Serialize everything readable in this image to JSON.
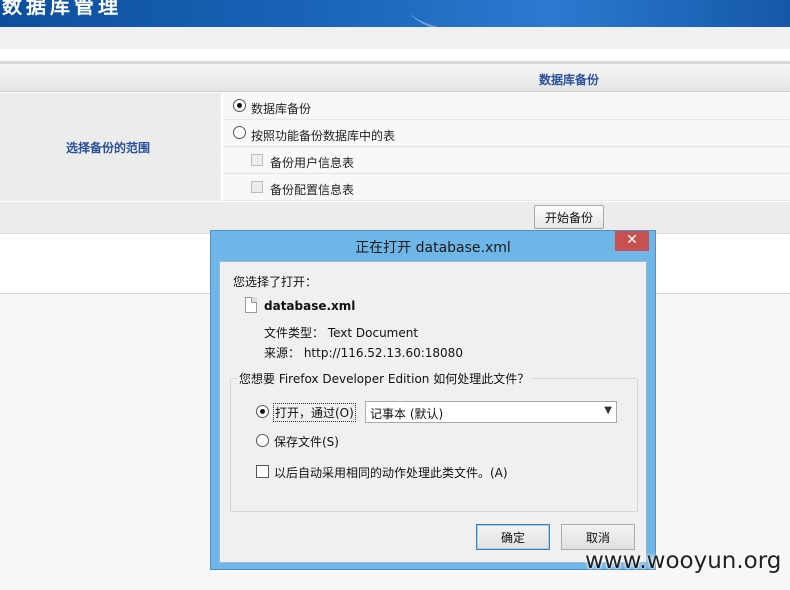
{
  "banner": {
    "title": "数据库管理"
  },
  "panel": {
    "title": "数据库备份"
  },
  "scope": {
    "label": "选择备份的范围",
    "options": [
      {
        "label": "数据库备份",
        "selected": true
      },
      {
        "label": "按照功能备份数据库中的表",
        "selected": false
      }
    ],
    "tables": [
      {
        "label": "备份用户信息表",
        "checked": false
      },
      {
        "label": "备份配置信息表",
        "checked": false
      }
    ]
  },
  "start_button": "开始备份",
  "dialog": {
    "title": "正在打开 database.xml",
    "close": "✕",
    "chosen_label": "您选择了打开：",
    "file_name": "database.xml",
    "file_type": "文件类型： Text Document",
    "source": "来源： http://116.52.13.60:18080",
    "question": "您想要 Firefox Developer Edition 如何处理此文件？",
    "open_with": {
      "label": "打开，通过(O)",
      "selected": true
    },
    "app_select": "记事本 (默认)",
    "save_file": {
      "label": "保存文件(S)",
      "selected": false
    },
    "remember": {
      "label": "以后自动采用相同的动作处理此类文件。(A)",
      "checked": false
    },
    "ok": "确定",
    "cancel": "取消"
  },
  "watermark": "www.wooyun.org",
  "colors": {
    "accent": "#2a5298",
    "dialog_frame": "#6fb6e8",
    "close": "#c75050"
  }
}
